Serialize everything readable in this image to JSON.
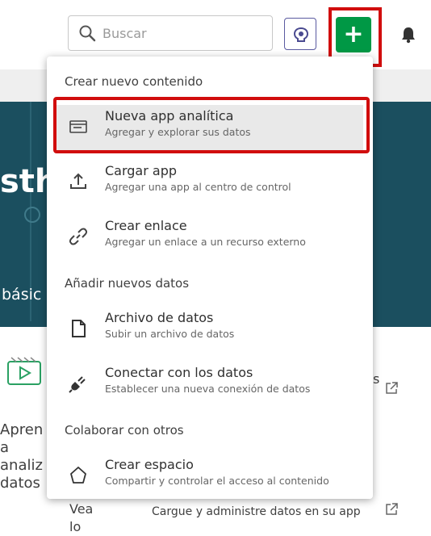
{
  "search": {
    "placeholder": "Buscar"
  },
  "background": {
    "hero_fragment": "sthe",
    "basic_fragment": "básic",
    "s_fragment": "s",
    "card_left_text": "Apren\na\nanaliz\ndatos",
    "vea_text": "Vea\nlo",
    "cargue": "Cargue y administre datos en su app"
  },
  "menu": {
    "sections": [
      {
        "title": "Crear nuevo contenido"
      },
      {
        "title": "Añadir nuevos datos"
      },
      {
        "title": "Colaborar con otros"
      }
    ],
    "items": [
      {
        "title": "Nueva app analítica",
        "subtitle": "Agregar y explorar sus datos",
        "icon": "analytics-app-icon"
      },
      {
        "title": "Cargar app",
        "subtitle": "Agregar una app al centro de control",
        "icon": "upload-icon"
      },
      {
        "title": "Crear enlace",
        "subtitle": "Agregar un enlace a un recurso externo",
        "icon": "link-icon"
      },
      {
        "title": "Archivo de datos",
        "subtitle": "Subir un archivo de datos",
        "icon": "file-icon"
      },
      {
        "title": "Conectar con los datos",
        "subtitle": "Establecer una nueva conexión de datos",
        "icon": "plug-icon"
      },
      {
        "title": "Crear espacio",
        "subtitle": "Compartir y controlar el acceso al contenido",
        "icon": "space-icon"
      }
    ]
  },
  "colors": {
    "accent_green": "#009845",
    "highlight_red": "#d10d0d",
    "hub_teal": "#1b4f5f"
  }
}
